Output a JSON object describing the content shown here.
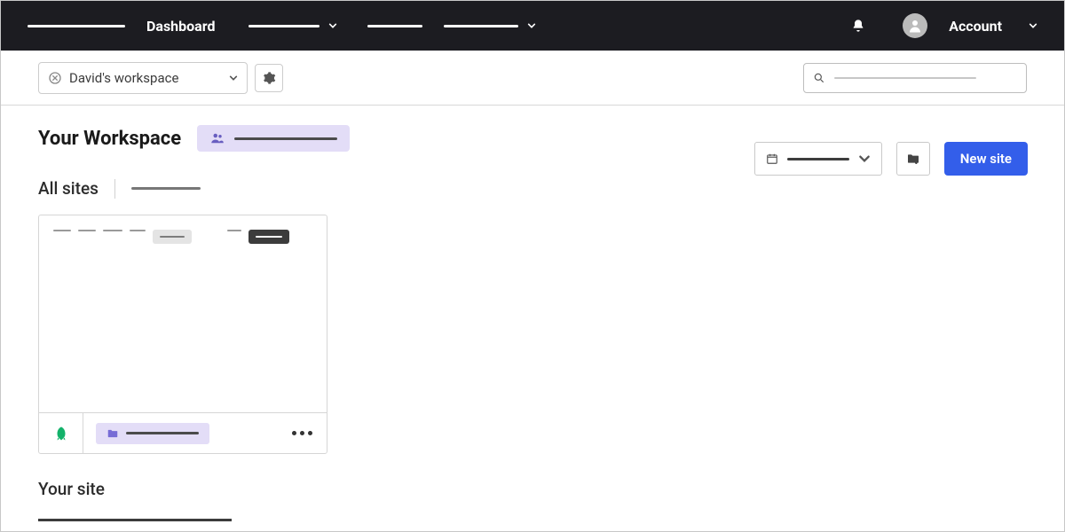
{
  "nav": {
    "dashboard": "Dashboard",
    "account": "Account"
  },
  "workspace_selector": {
    "name": "David's workspace"
  },
  "workspace": {
    "title": "Your Workspace",
    "all_sites": "All sites",
    "your_site": "Your site"
  },
  "actions": {
    "new_site": "New site"
  }
}
